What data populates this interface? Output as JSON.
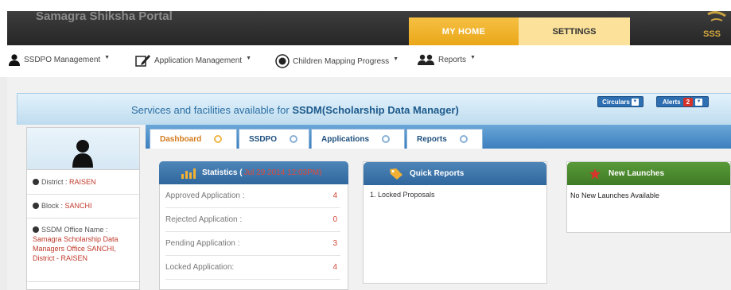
{
  "header": {
    "portal_title": "Samagra Shiksha Portal",
    "tabs": [
      {
        "label": "MY HOME"
      },
      {
        "label": "SETTINGS"
      }
    ],
    "logo_text": "SSS"
  },
  "menu": [
    {
      "label": "SSDPO Management",
      "icon": "user-icon"
    },
    {
      "label": "Application Management",
      "icon": "edit-icon"
    },
    {
      "label": "Children Mapping Progress",
      "icon": "target-icon"
    },
    {
      "label": "Reports",
      "icon": "users-icon"
    }
  ],
  "banner": {
    "prefix": "Services and facilities available for ",
    "highlight": "SSDM(Scholarship Data Manager)",
    "circulars_label": "Circulars",
    "alerts_label": "Alerts",
    "alerts_count": "2"
  },
  "profile": {
    "district_label": "District : ",
    "district_value": "RAISEN",
    "block_label": "Block : ",
    "block_value": "SANCHI",
    "office_label": "SSDM Office Name :",
    "office_value": "Samagra Scholarship Data Managers Office SANCHI, District - RAISEN"
  },
  "tabs": [
    {
      "label": "Dashboard"
    },
    {
      "label": "SSDPO"
    },
    {
      "label": "Applications"
    },
    {
      "label": "Reports"
    }
  ],
  "statistics": {
    "title": "Statistics (",
    "date": "Jul 29 2014 12:03PM)",
    "rows": [
      {
        "label": "Approved Application :",
        "value": "4"
      },
      {
        "label": "Rejected Application :",
        "value": "0"
      },
      {
        "label": "Pending Application :",
        "value": "3"
      },
      {
        "label": "Locked Application:",
        "value": "4"
      }
    ]
  },
  "quick_reports": {
    "title": "Quick Reports",
    "items": [
      "1.  Locked Proposals"
    ]
  },
  "new_launches": {
    "title": "New Launches",
    "message": "No New Launches Available"
  },
  "colors": {
    "header_dark": "#2e2e2e",
    "tab_active": "#eaa718",
    "tab_settings": "#fbe19a",
    "accent_blue": "#3d7fbe",
    "quick_green": "#4f8a2e",
    "value_red": "#d0473b"
  }
}
